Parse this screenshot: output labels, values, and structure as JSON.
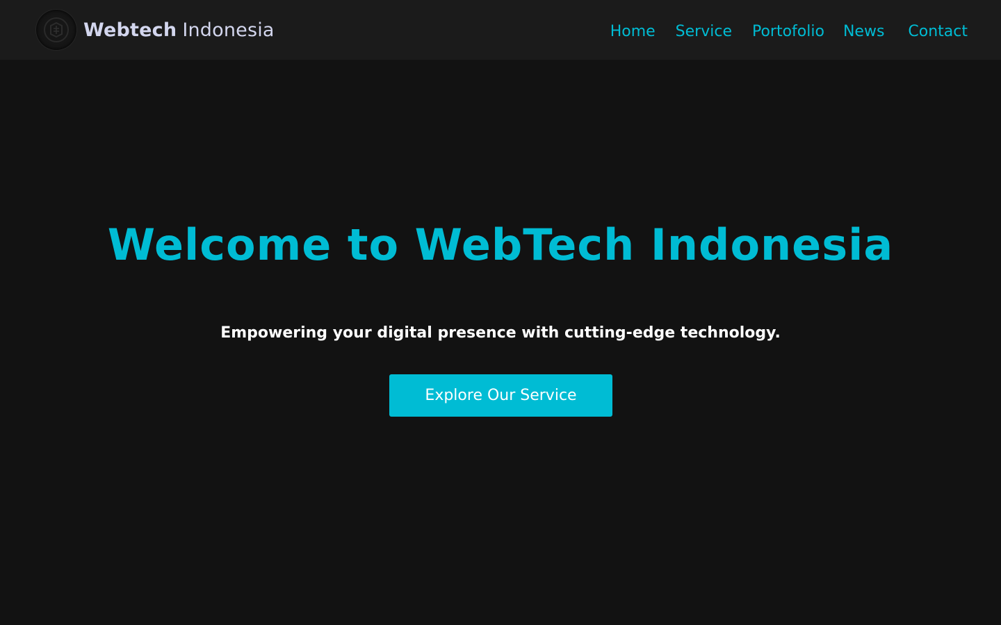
{
  "header": {
    "brand_bold": "Webtech",
    "brand_light": "Indonesia",
    "logo_icon": "circuit-logo-icon"
  },
  "nav": {
    "items": [
      {
        "label": "Home"
      },
      {
        "label": "Service"
      },
      {
        "label": "Portofolio"
      },
      {
        "label": "News"
      },
      {
        "label": "Contact"
      }
    ]
  },
  "hero": {
    "title": "Welcome to WebTech Indonesia",
    "subtitle": "Empowering your digital presence with cutting-edge technology.",
    "cta_label": "Explore Our Service"
  },
  "colors": {
    "accent": "#00bcd4",
    "background": "#121212",
    "navbar_background": "#1b1b1b",
    "brand_text": "#d3d6ee"
  }
}
